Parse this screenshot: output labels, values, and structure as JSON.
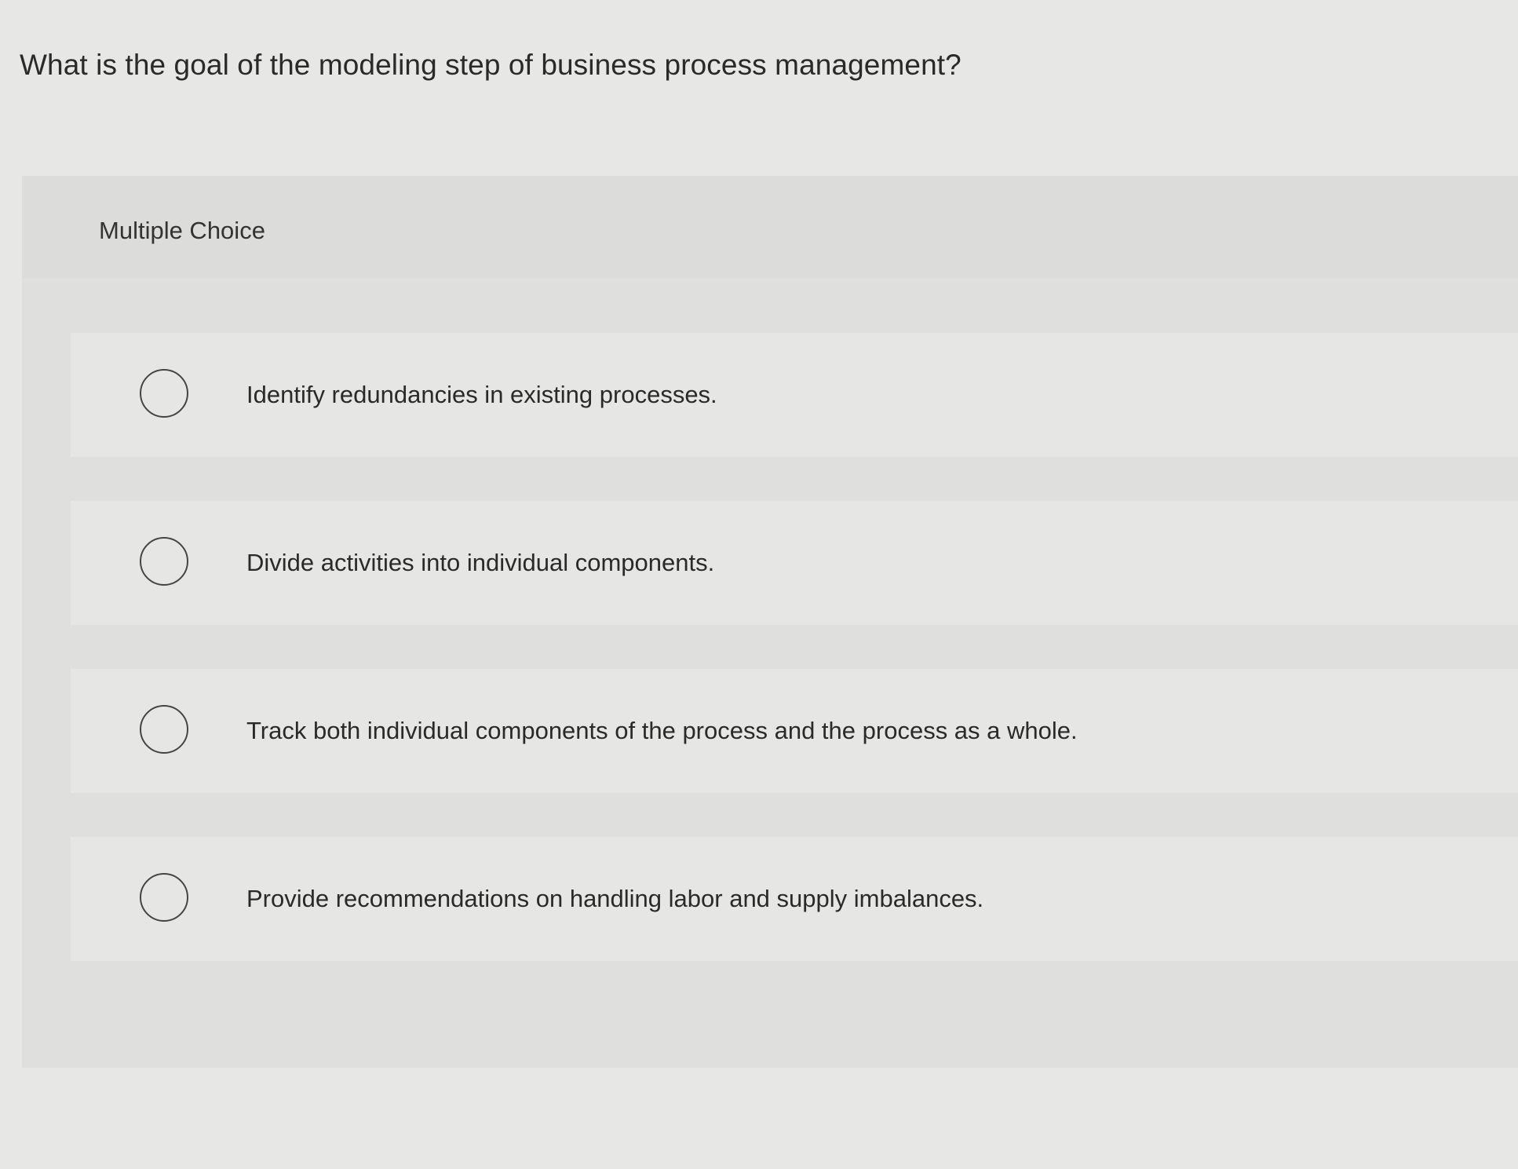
{
  "question": {
    "text": "What is the goal of the modeling step of business process management?"
  },
  "panel": {
    "label": "Multiple Choice"
  },
  "options": [
    {
      "text": "Identify redundancies in existing processes."
    },
    {
      "text": "Divide activities into individual components."
    },
    {
      "text": "Track both individual components of the process and the process as a whole."
    },
    {
      "text": "Provide recommendations on handling labor and supply imbalances."
    }
  ],
  "colors": {
    "background": "#e7e7e5",
    "panel": "#dfdfdd",
    "option_row": "#e6e6e4",
    "radio_border": "#454545",
    "text": "#2a2a2a"
  }
}
